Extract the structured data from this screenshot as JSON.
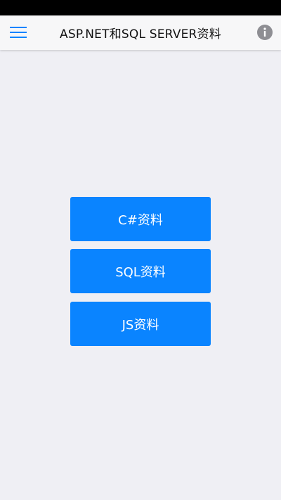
{
  "header": {
    "title": "ASP.NET和SQL SERVER资料",
    "menu_icon": "hamburger-menu-icon",
    "info_icon": "info-icon"
  },
  "buttons": [
    {
      "label": "C#资料"
    },
    {
      "label": "SQL资料"
    },
    {
      "label": "JS资料"
    }
  ],
  "colors": {
    "accent": "#0a84ff",
    "background": "#efeff4",
    "header_bg": "#f7f7f8",
    "info_icon": "#8e8e93"
  }
}
